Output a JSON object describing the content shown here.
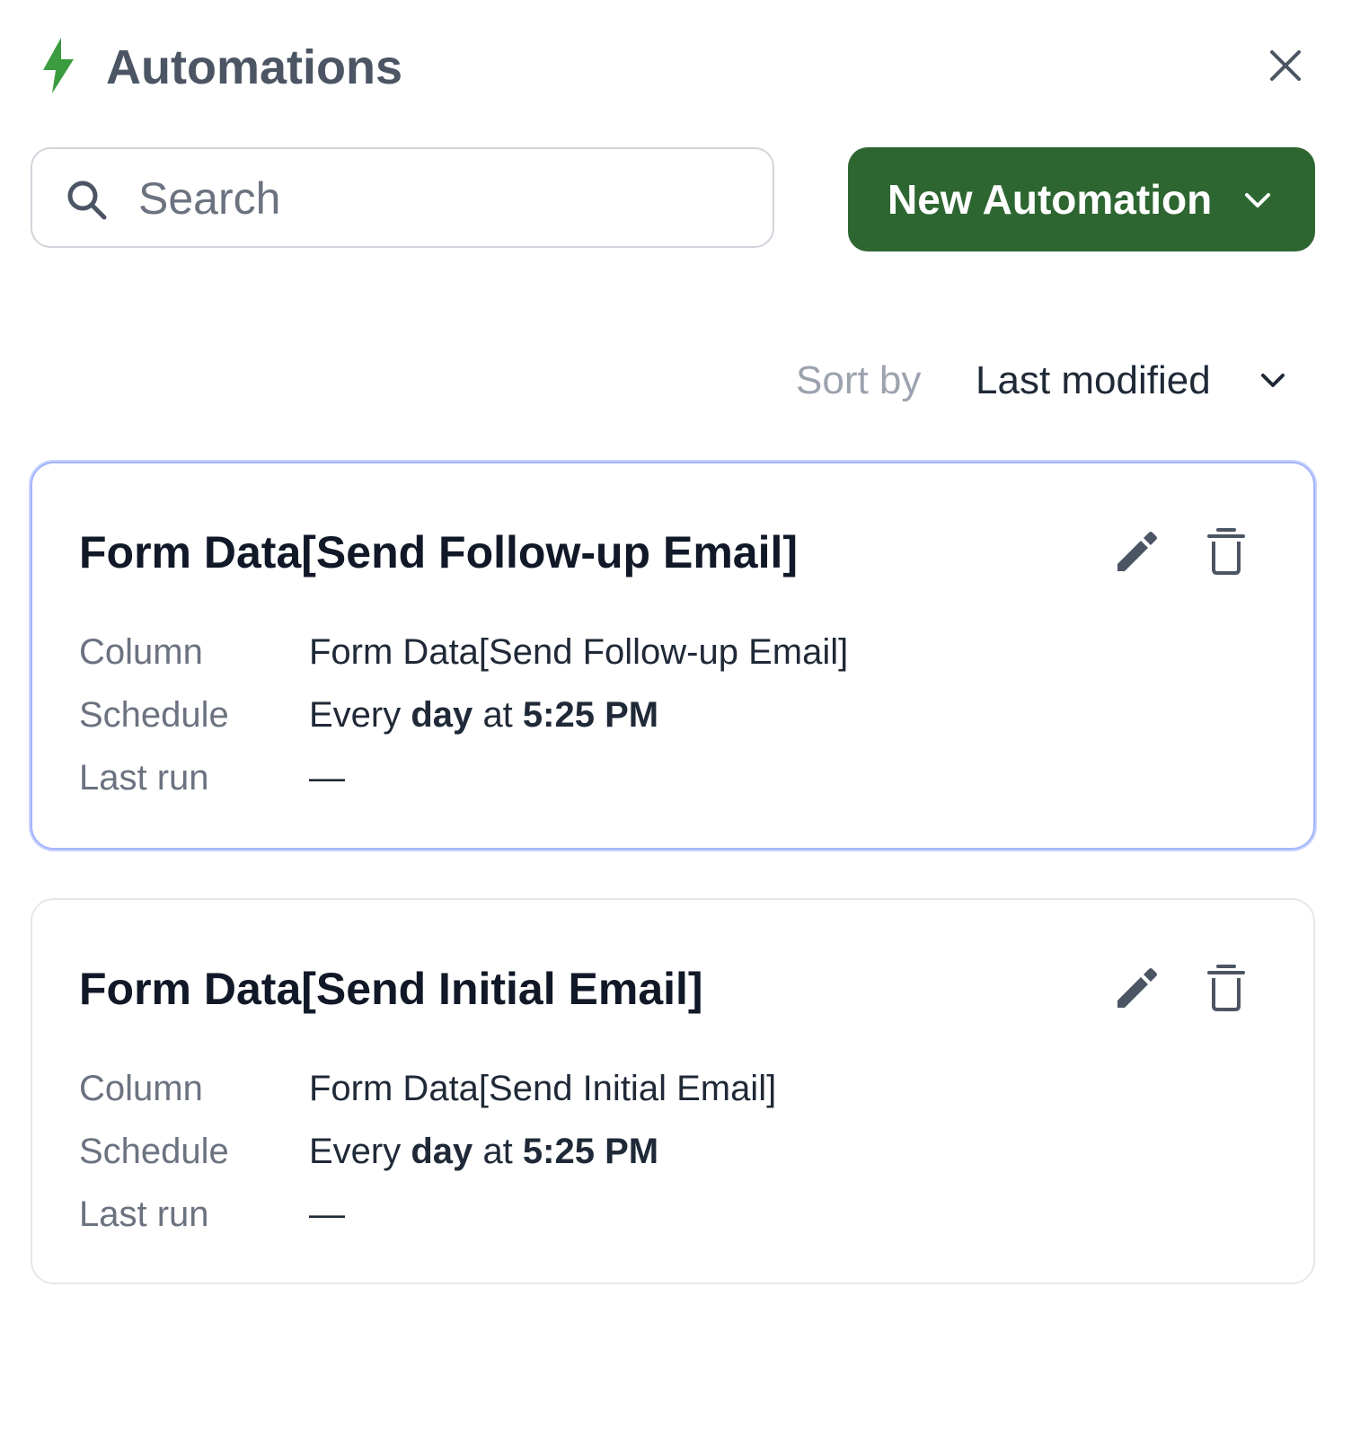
{
  "header": {
    "title": "Automations",
    "icon": "lightning-bolt-icon",
    "accent": "#3a9b3f",
    "close_icon": "close-icon"
  },
  "search": {
    "placeholder": "Search",
    "value": ""
  },
  "new_automation": {
    "label": "New Automation",
    "color": "#2e6631"
  },
  "sort": {
    "label": "Sort by",
    "value": "Last modified"
  },
  "automations": [
    {
      "name": "Form Data[Send Follow-up Email]",
      "fields": {
        "column_label": "Column",
        "column_value": "Form Data[Send Follow-up Email]",
        "schedule_label": "Schedule",
        "schedule_prefix": "Every",
        "schedule_unit": "day",
        "schedule_mid": "at",
        "schedule_time": "5:25 PM",
        "last_run_label": "Last run",
        "last_run_value": "—"
      },
      "selected": true
    },
    {
      "name": "Form Data[Send Initial Email]",
      "fields": {
        "column_label": "Column",
        "column_value": "Form Data[Send Initial Email]",
        "schedule_label": "Schedule",
        "schedule_prefix": "Every",
        "schedule_unit": "day",
        "schedule_mid": "at",
        "schedule_time": "5:25 PM",
        "last_run_label": "Last run",
        "last_run_value": "—"
      },
      "selected": false
    }
  ]
}
